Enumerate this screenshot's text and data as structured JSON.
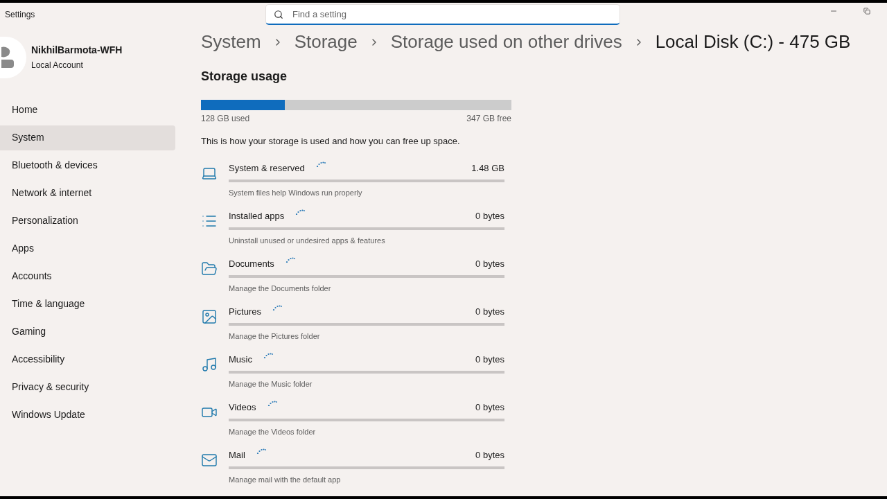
{
  "window": {
    "title": "Settings"
  },
  "search": {
    "placeholder": "Find a setting"
  },
  "account": {
    "name": "NikhilBarmota-WFH",
    "type": "Local Account"
  },
  "nav": [
    {
      "label": "Home",
      "selected": false
    },
    {
      "label": "System",
      "selected": true
    },
    {
      "label": "Bluetooth & devices",
      "selected": false
    },
    {
      "label": "Network & internet",
      "selected": false
    },
    {
      "label": "Personalization",
      "selected": false
    },
    {
      "label": "Apps",
      "selected": false
    },
    {
      "label": "Accounts",
      "selected": false
    },
    {
      "label": "Time & language",
      "selected": false
    },
    {
      "label": "Gaming",
      "selected": false
    },
    {
      "label": "Accessibility",
      "selected": false
    },
    {
      "label": "Privacy & security",
      "selected": false
    },
    {
      "label": "Windows Update",
      "selected": false
    }
  ],
  "breadcrumb": [
    "System",
    "Storage",
    "Storage used on other drives",
    "Local Disk (C:) - 475 GB"
  ],
  "section_title": "Storage usage",
  "usage": {
    "level": 0.27,
    "used": "128 GB used",
    "free": "347 GB free"
  },
  "description": "This is how your storage is used and how you can free up space.",
  "categories": [
    {
      "kind": "laptop",
      "name": "System & reserved",
      "size": "1.48 GB",
      "hint": "System files help Windows run properly"
    },
    {
      "kind": "list",
      "name": "Installed apps",
      "size": "0 bytes",
      "hint": "Uninstall unused or undesired apps & features"
    },
    {
      "kind": "folder",
      "name": "Documents",
      "size": "0 bytes",
      "hint": "Manage the Documents folder"
    },
    {
      "kind": "image",
      "name": "Pictures",
      "size": "0 bytes",
      "hint": "Manage the Pictures folder"
    },
    {
      "kind": "music",
      "name": "Music",
      "size": "0 bytes",
      "hint": "Manage the Music folder"
    },
    {
      "kind": "video",
      "name": "Videos",
      "size": "0 bytes",
      "hint": "Manage the Videos folder"
    },
    {
      "kind": "mail",
      "name": "Mail",
      "size": "0 bytes",
      "hint": "Manage mail with the default app"
    }
  ]
}
